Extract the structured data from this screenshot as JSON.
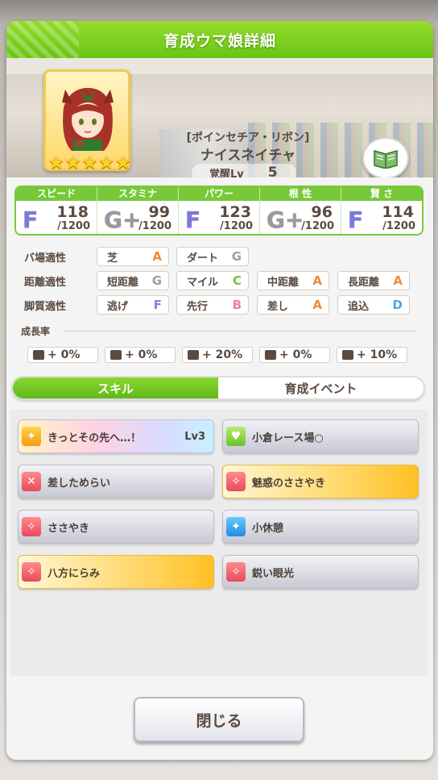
{
  "header": {
    "title": "育成ウマ娘詳細"
  },
  "character": {
    "epithet": "[ポインセチア・リボン]",
    "name": "ナイスネイチャ",
    "stars": 5,
    "awakening_label": "覚醒Lv",
    "awakening_value": "5"
  },
  "stats": [
    {
      "label": "スピード",
      "grade": "F",
      "value": "118",
      "max": "/1200"
    },
    {
      "label": "スタミナ",
      "grade": "G+",
      "value": "99",
      "max": "/1200"
    },
    {
      "label": "パワー",
      "grade": "F",
      "value": "123",
      "max": "/1200"
    },
    {
      "label": "根 性",
      "grade": "G+",
      "value": "96",
      "max": "/1200"
    },
    {
      "label": "賢 さ",
      "grade": "F",
      "value": "114",
      "max": "/1200"
    }
  ],
  "aptitude": {
    "track": {
      "label": "バ場適性",
      "items": [
        {
          "name": "芝",
          "rank": "A"
        },
        {
          "name": "ダート",
          "rank": "G"
        }
      ]
    },
    "distance": {
      "label": "距離適性",
      "items": [
        {
          "name": "短距離",
          "rank": "G"
        },
        {
          "name": "マイル",
          "rank": "C"
        },
        {
          "name": "中距離",
          "rank": "A"
        },
        {
          "name": "長距離",
          "rank": "A"
        }
      ]
    },
    "style": {
      "label": "脚質適性",
      "items": [
        {
          "name": "逃げ",
          "rank": "F"
        },
        {
          "name": "先行",
          "rank": "B"
        },
        {
          "name": "差し",
          "rank": "A"
        },
        {
          "name": "追込",
          "rank": "D"
        }
      ]
    }
  },
  "growth": {
    "label": "成長率",
    "items": [
      "+ 0%",
      "+ 0%",
      "+ 20%",
      "+ 0%",
      "+ 10%"
    ]
  },
  "tabs": {
    "skills": "スキル",
    "events": "育成イベント"
  },
  "skills": [
    {
      "name": "きっとその先へ…！",
      "level": "Lv3"
    },
    {
      "name": "小倉レース場○"
    },
    {
      "name": "差しためらい"
    },
    {
      "name": "魅惑のささやき"
    },
    {
      "name": "ささやき"
    },
    {
      "name": "小休憩"
    },
    {
      "name": "八方にらみ"
    },
    {
      "name": "鋭い眼光"
    }
  ],
  "close_button": "閉じる",
  "colors": {
    "accent_green": "#78c93a",
    "header_green": "#6ac414",
    "text_brown": "#5a4a40"
  }
}
